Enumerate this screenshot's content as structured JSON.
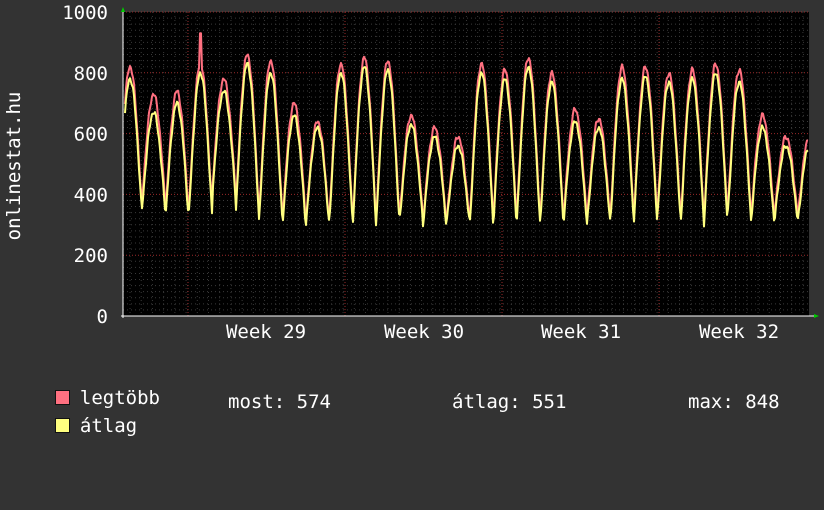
{
  "chart_data": {
    "type": "line",
    "ylabel": "onlinestat.hu",
    "ylim": [
      0,
      1000
    ],
    "yticks": [
      "0",
      "200",
      "400",
      "600",
      "800",
      "1000"
    ],
    "xticks": [
      "Week 29",
      "Week 30",
      "Week 31",
      "Week 32"
    ],
    "grid": true,
    "series": [
      {
        "name": "legtöbb",
        "color": "#ff7080",
        "peaks": [
          820,
          730,
          740,
          830,
          780,
          860,
          840,
          700,
          640,
          830,
          850,
          840,
          660,
          620,
          590,
          830,
          810,
          850,
          800,
          680,
          650,
          820,
          820,
          800,
          810,
          830,
          810,
          660,
          590
        ],
        "troughs": [
          360,
          380,
          340,
          350,
          420,
          350,
          330,
          320,
          310,
          320,
          310,
          320,
          330,
          310,
          310,
          320,
          320,
          320,
          320,
          330,
          320,
          330,
          330,
          330,
          320,
          330,
          340,
          330,
          330
        ]
      },
      {
        "name": "átlag",
        "color": "#ffff80",
        "peaks": [
          780,
          670,
          700,
          800,
          740,
          830,
          800,
          660,
          620,
          800,
          820,
          810,
          630,
          590,
          560,
          800,
          780,
          820,
          770,
          640,
          620,
          780,
          790,
          770,
          780,
          800,
          770,
          620,
          560
        ],
        "troughs": [
          340,
          350,
          320,
          330,
          400,
          330,
          310,
          300,
          300,
          300,
          300,
          300,
          310,
          300,
          300,
          300,
          300,
          300,
          300,
          310,
          300,
          310,
          310,
          310,
          300,
          310,
          320,
          310,
          310
        ]
      }
    ],
    "spikes": [
      {
        "series": 0,
        "cycle": 3,
        "value": 930
      }
    ]
  },
  "legend": {
    "items": [
      {
        "label": "legtöbb",
        "color": "#ff7080"
      },
      {
        "label": "átlag",
        "color": "#ffff80"
      }
    ],
    "stats": {
      "now": "most: 574",
      "avg": "átlag: 551",
      "max": "max: 848"
    }
  }
}
